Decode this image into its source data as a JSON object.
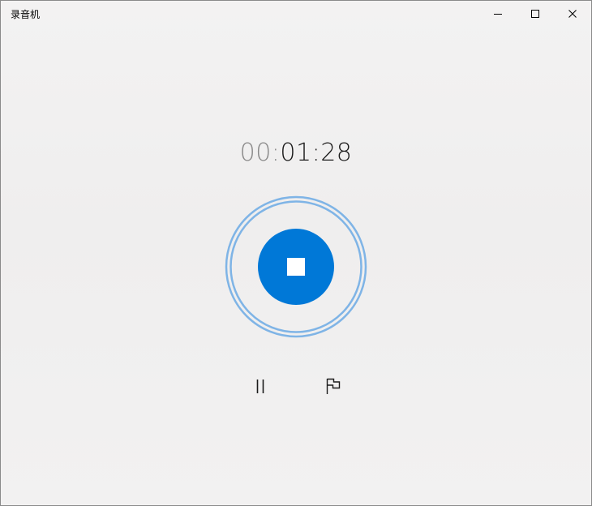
{
  "window": {
    "title": "录音机",
    "minimize_icon": "minimize-icon",
    "maximize_icon": "maximize-icon",
    "close_icon": "close-icon"
  },
  "timer": {
    "hours": "00",
    "separator_1": ":",
    "minutes": "01",
    "separator_2": ":",
    "seconds": "28"
  },
  "controls": {
    "stop_icon": "stop-icon",
    "pause_icon": "pause-icon",
    "flag_icon": "flag-icon"
  },
  "colors": {
    "accent": "#0078d7",
    "ring": "#7fb4e6",
    "timer_dim": "#8a8a8a",
    "timer_text": "#1b1b1b"
  }
}
